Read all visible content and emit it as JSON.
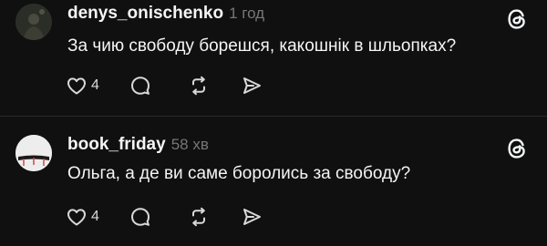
{
  "app": {
    "accent_text": "#f3f5f7",
    "muted_text": "#777777",
    "background": "#101010"
  },
  "posts": [
    {
      "username": "denys_onischenko",
      "time": "1 год",
      "text": "За чию свободу борешся, какошнік в шльопках?",
      "like_count": "4",
      "icons": [
        "threads-logo-icon",
        "heart-icon",
        "comment-icon",
        "repost-icon",
        "share-icon"
      ]
    },
    {
      "username": "book_friday",
      "time": "58 хв",
      "text": "Ольга, а де ви саме боролись за свободу?",
      "like_count": "4",
      "icons": [
        "threads-logo-icon",
        "heart-icon",
        "comment-icon",
        "repost-icon",
        "share-icon"
      ]
    }
  ]
}
